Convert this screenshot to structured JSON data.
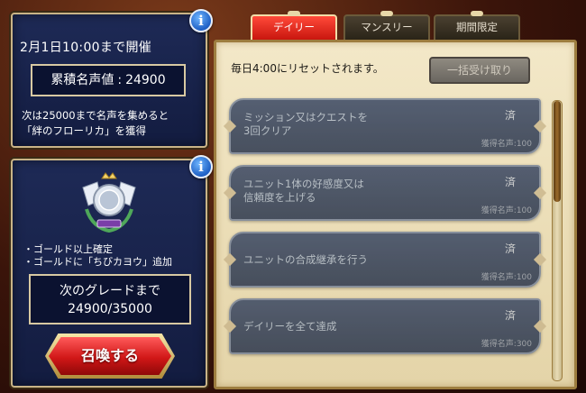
{
  "event": {
    "period_text": "2月1日10:00まで開催",
    "fame_label": "累積名声値",
    "fame_sep": ":",
    "fame_value": "24900",
    "reward_line1": "次は25000まで名声を集めると",
    "reward_line2": "「絆のフローリカ」を獲得"
  },
  "grade": {
    "bullet1": "・ゴールド以上確定",
    "bullet2": "・ゴールドに「ちびカヨウ」追加",
    "next_label": "次のグレードまで",
    "progress": "24900/35000",
    "progress_fraction": 0.711,
    "summon_label": "召喚する"
  },
  "tabs": [
    {
      "label": "デイリー",
      "active": true
    },
    {
      "label": "マンスリー",
      "active": false
    },
    {
      "label": "期間限定",
      "active": false
    }
  ],
  "missions_header": {
    "reset_note": "毎日4:00にリセットされます。",
    "claim_all_label": "一括受け取り"
  },
  "missions": [
    {
      "title": "ミッション又はクエストを\n3回クリア",
      "status": "済",
      "reward": "獲得名声:100"
    },
    {
      "title": "ユニット1体の好感度又は\n信頼度を上げる",
      "status": "済",
      "reward": "獲得名声:100"
    },
    {
      "title": "ユニットの合成継承を行う",
      "status": "済",
      "reward": "獲得名声:100"
    },
    {
      "title": "デイリーを全て達成",
      "status": "済",
      "reward": "獲得名声:300"
    }
  ],
  "info_icon": "i",
  "colors": {
    "panel_bg": "#1e2a56",
    "tab_active": "#d11f14",
    "summon_button": "#d11717",
    "mission_bg": "#f3e8c8"
  }
}
